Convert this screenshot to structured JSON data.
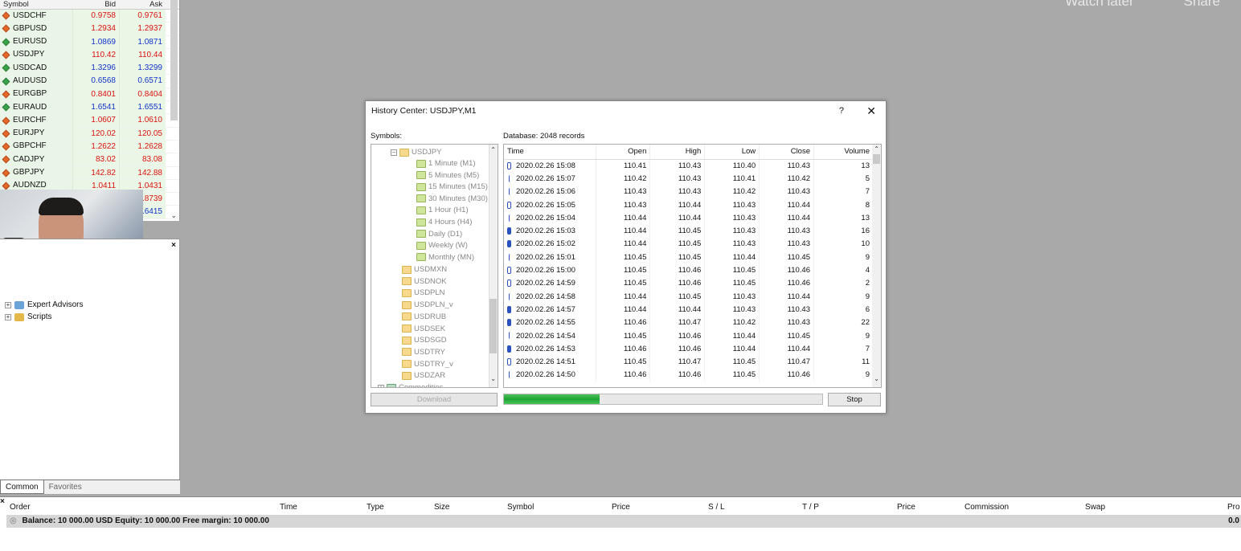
{
  "overlay": {
    "watch_later": "Watch later",
    "share": "Share"
  },
  "market_watch": {
    "headers": {
      "symbol": "Symbol",
      "bid": "Bid",
      "ask": "Ask"
    },
    "rows": [
      {
        "symbol": "USDCHF",
        "bid": "0.9758",
        "ask": "0.9761",
        "dir": "dn",
        "color": "red"
      },
      {
        "symbol": "GBPUSD",
        "bid": "1.2934",
        "ask": "1.2937",
        "dir": "dn",
        "color": "red"
      },
      {
        "symbol": "EURUSD",
        "bid": "1.0869",
        "ask": "1.0871",
        "dir": "up",
        "color": "blue"
      },
      {
        "symbol": "USDJPY",
        "bid": "110.42",
        "ask": "110.44",
        "dir": "dn",
        "color": "red"
      },
      {
        "symbol": "USDCAD",
        "bid": "1.3296",
        "ask": "1.3299",
        "dir": "up",
        "color": "blue"
      },
      {
        "symbol": "AUDUSD",
        "bid": "0.6568",
        "ask": "0.6571",
        "dir": "up",
        "color": "blue"
      },
      {
        "symbol": "EURGBP",
        "bid": "0.8401",
        "ask": "0.8404",
        "dir": "dn",
        "color": "red"
      },
      {
        "symbol": "EURAUD",
        "bid": "1.6541",
        "ask": "1.6551",
        "dir": "up",
        "color": "blue"
      },
      {
        "symbol": "EURCHF",
        "bid": "1.0607",
        "ask": "1.0610",
        "dir": "dn",
        "color": "red"
      },
      {
        "symbol": "EURJPY",
        "bid": "120.02",
        "ask": "120.05",
        "dir": "dn",
        "color": "red"
      },
      {
        "symbol": "GBPCHF",
        "bid": "1.2622",
        "ask": "1.2628",
        "dir": "dn",
        "color": "red"
      },
      {
        "symbol": "CADJPY",
        "bid": "83.02",
        "ask": "83.08",
        "dir": "dn",
        "color": "red"
      },
      {
        "symbol": "GBPJPY",
        "bid": "142.82",
        "ask": "142.88",
        "dir": "dn",
        "color": "red"
      },
      {
        "symbol": "AUDNZD",
        "bid": "1.0411",
        "ask": "1.0431",
        "dir": "dn",
        "color": "red"
      },
      {
        "symbol": "",
        "bid": "",
        "ask": "0.8739",
        "dir": "",
        "color": "red"
      },
      {
        "symbol": "",
        "bid": "",
        "ask": "0.6415",
        "dir": "",
        "color": "blue"
      }
    ]
  },
  "navigator": {
    "items": [
      "Expert Advisors",
      "Scripts"
    ],
    "tabs": [
      "Common",
      "Favorites"
    ]
  },
  "dialog": {
    "title": "History Center: USDJPY,M1",
    "help": "?",
    "close": "✕",
    "symbols_label": "Symbols:",
    "database_label": "Database: 2048 records",
    "tree": {
      "root": "USDJPY",
      "timeframes": [
        "1 Minute (M1)",
        "5 Minutes (M5)",
        "15 Minutes (M15)",
        "30 Minutes (M30)",
        "1 Hour (H1)",
        "4 Hours (H4)",
        "Daily (D1)",
        "Weekly (W)",
        "Monthly (MN)"
      ],
      "symbols": [
        "USDMXN",
        "USDNOK",
        "USDPLN",
        "USDPLN_v",
        "USDRUB",
        "USDSEK",
        "USDSGD",
        "USDTRY",
        "USDTRY_v",
        "USDZAR"
      ],
      "last": "Commodities"
    },
    "columns": [
      "Time",
      "Open",
      "High",
      "Low",
      "Close",
      "Volume"
    ],
    "rows": [
      {
        "c": "hollow",
        "time": "2020.02.26 15:08",
        "open": "110.41",
        "high": "110.43",
        "low": "110.40",
        "close": "110.43",
        "vol": "13"
      },
      {
        "c": "doji",
        "time": "2020.02.26 15:07",
        "open": "110.42",
        "high": "110.43",
        "low": "110.41",
        "close": "110.42",
        "vol": "5"
      },
      {
        "c": "doji",
        "time": "2020.02.26 15:06",
        "open": "110.43",
        "high": "110.43",
        "low": "110.42",
        "close": "110.43",
        "vol": "7"
      },
      {
        "c": "hollow",
        "time": "2020.02.26 15:05",
        "open": "110.43",
        "high": "110.44",
        "low": "110.43",
        "close": "110.44",
        "vol": "8"
      },
      {
        "c": "doji",
        "time": "2020.02.26 15:04",
        "open": "110.44",
        "high": "110.44",
        "low": "110.43",
        "close": "110.44",
        "vol": "13"
      },
      {
        "c": "filled",
        "time": "2020.02.26 15:03",
        "open": "110.44",
        "high": "110.45",
        "low": "110.43",
        "close": "110.43",
        "vol": "16"
      },
      {
        "c": "filled",
        "time": "2020.02.26 15:02",
        "open": "110.44",
        "high": "110.45",
        "low": "110.43",
        "close": "110.43",
        "vol": "10"
      },
      {
        "c": "doji",
        "time": "2020.02.26 15:01",
        "open": "110.45",
        "high": "110.45",
        "low": "110.44",
        "close": "110.45",
        "vol": "9"
      },
      {
        "c": "hollow",
        "time": "2020.02.26 15:00",
        "open": "110.45",
        "high": "110.46",
        "low": "110.45",
        "close": "110.46",
        "vol": "4"
      },
      {
        "c": "hollow",
        "time": "2020.02.26 14:59",
        "open": "110.45",
        "high": "110.46",
        "low": "110.45",
        "close": "110.46",
        "vol": "2"
      },
      {
        "c": "doji",
        "time": "2020.02.26 14:58",
        "open": "110.44",
        "high": "110.45",
        "low": "110.43",
        "close": "110.44",
        "vol": "9"
      },
      {
        "c": "filled",
        "time": "2020.02.26 14:57",
        "open": "110.44",
        "high": "110.44",
        "low": "110.43",
        "close": "110.43",
        "vol": "6"
      },
      {
        "c": "filled",
        "time": "2020.02.26 14:55",
        "open": "110.46",
        "high": "110.47",
        "low": "110.42",
        "close": "110.43",
        "vol": "22"
      },
      {
        "c": "doji",
        "time": "2020.02.26 14:54",
        "open": "110.45",
        "high": "110.46",
        "low": "110.44",
        "close": "110.45",
        "vol": "9"
      },
      {
        "c": "filled",
        "time": "2020.02.26 14:53",
        "open": "110.46",
        "high": "110.46",
        "low": "110.44",
        "close": "110.44",
        "vol": "7"
      },
      {
        "c": "hollow",
        "time": "2020.02.26 14:51",
        "open": "110.45",
        "high": "110.47",
        "low": "110.45",
        "close": "110.47",
        "vol": "11"
      },
      {
        "c": "doji",
        "time": "2020.02.26 14:50",
        "open": "110.46",
        "high": "110.46",
        "low": "110.45",
        "close": "110.46",
        "vol": "9"
      }
    ],
    "download": "Download",
    "stop": "Stop",
    "progress": 0.3
  },
  "terminal": {
    "close": "×",
    "columns": [
      "Order",
      "Time",
      "Type",
      "Size",
      "Symbol",
      "Price",
      "S / L",
      "T / P",
      "Price",
      "Commission",
      "Swap",
      "Pro"
    ],
    "balance": "Balance: 10 000.00 USD  Equity: 10 000.00  Free margin: 10 000.00",
    "profit": "0.0"
  }
}
